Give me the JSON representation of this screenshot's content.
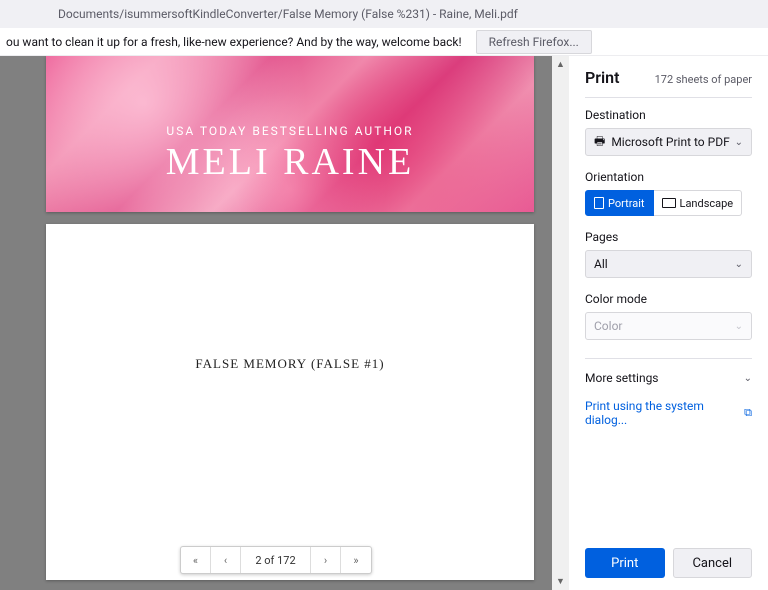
{
  "tab": {
    "title": "Documents/isummersoftKindleConverter/False Memory (False %231) - Raine, Meli.pdf"
  },
  "notif": {
    "text": "ou want to clean it up for a fresh, like-new experience? And by the way, welcome back!",
    "button": "Refresh Firefox..."
  },
  "preview": {
    "cover_line1": "USA TODAY BESTSELLING AUTHOR",
    "cover_line2": "MELI RAINE",
    "page2_title": "FALSE MEMORY (FALSE #1)",
    "pager": "2 of 172"
  },
  "print": {
    "title": "Print",
    "sheet_count": "172 sheets of paper",
    "destination_label": "Destination",
    "destination_value": "Microsoft Print to PDF",
    "orientation_label": "Orientation",
    "portrait": "Portrait",
    "landscape": "Landscape",
    "pages_label": "Pages",
    "pages_value": "All",
    "color_label": "Color mode",
    "color_value": "Color",
    "more_settings": "More settings",
    "system_link": "Print using the system dialog...",
    "print_btn": "Print",
    "cancel_btn": "Cancel"
  }
}
